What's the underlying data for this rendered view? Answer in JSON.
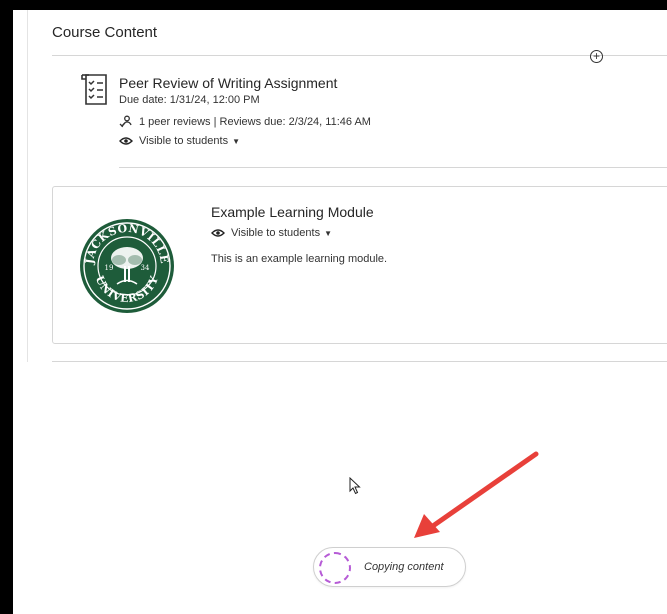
{
  "section": {
    "title": "Course Content"
  },
  "add_control": {
    "glyph": "+",
    "icon": "plus-circle-icon"
  },
  "peer_review": {
    "title": "Peer Review of Writing Assignment",
    "due": "Due date: 1/31/24, 12:00 PM",
    "reviews": "1 peer reviews | Reviews due: 2/3/24, 11:46 AM",
    "visibility": "Visible to students",
    "icon": "assignment-checklist-icon"
  },
  "module": {
    "title": "Example Learning Module",
    "visibility": "Visible to students",
    "description": "This is an example learning module.",
    "seal": {
      "top_text": "JACKSONVILLE",
      "bottom_text": "UNIVERSITY",
      "year_left": "19",
      "year_right": "34",
      "color": "#1e5c3a"
    }
  },
  "toast": {
    "text": "Copying content",
    "spinner_color": "#b65bd6"
  },
  "annotation": {
    "arrow_color": "#e8403a"
  },
  "colors": {
    "frame": "#000000",
    "rule": "#d6d6d6",
    "text": "#262626"
  }
}
